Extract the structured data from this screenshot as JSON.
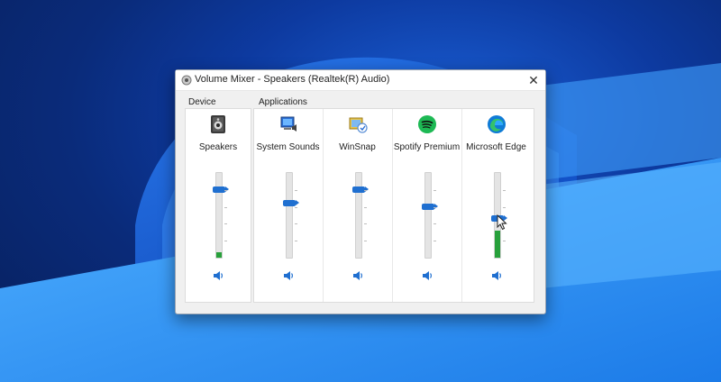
{
  "window": {
    "title": "Volume Mixer - Speakers (Realtek(R) Audio)",
    "close_glyph": "✕"
  },
  "groups": {
    "device_label": "Device",
    "applications_label": "Applications"
  },
  "device": {
    "label": "Speakers",
    "icon": "speaker-device-icon",
    "volume_percent": 80,
    "peak_percent": 6
  },
  "applications": [
    {
      "label": "System Sounds",
      "icon": "system-sounds-icon",
      "volume_percent": 64,
      "peak_percent": 0
    },
    {
      "label": "WinSnap",
      "icon": "winsnap-icon",
      "volume_percent": 80,
      "peak_percent": 0
    },
    {
      "label": "Spotify Premium",
      "icon": "spotify-icon",
      "volume_percent": 60,
      "peak_percent": 0
    },
    {
      "label": "Microsoft Edge",
      "icon": "edge-icon",
      "volume_percent": 46,
      "peak_percent": 32
    }
  ],
  "colors": {
    "thumb": "#1f6fd0",
    "peak_meter": "#27a03b",
    "desktop_blue": "#0a2b7a"
  }
}
